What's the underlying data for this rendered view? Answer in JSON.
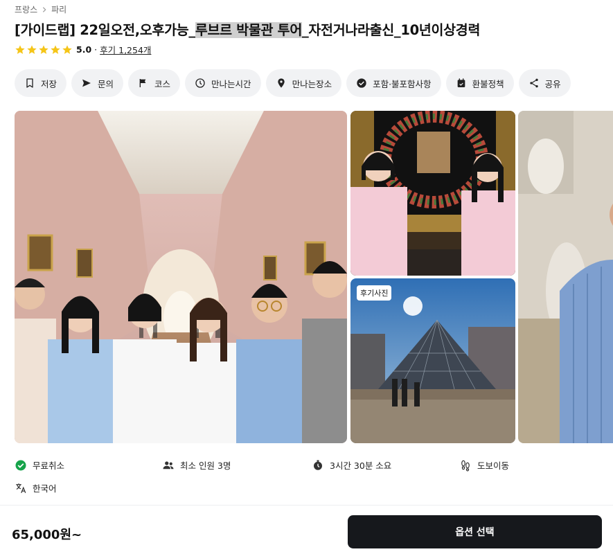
{
  "breadcrumb": {
    "items": [
      "프랑스",
      "파리"
    ]
  },
  "product": {
    "title_before": "[가이드랩] 22일오전,오후가능_",
    "title_highlight": "루브르 박물관 투어",
    "title_after": "_자전거나라출신_10년이상경력",
    "rating": "5.0",
    "separator": "·",
    "reviews": "후기 1,254개",
    "star_color": "#f5c518"
  },
  "actions": [
    {
      "label": "저장",
      "icon": "bookmark-icon"
    },
    {
      "label": "문의",
      "icon": "send-icon"
    },
    {
      "label": "코스",
      "icon": "flag-icon"
    },
    {
      "label": "만나는시간",
      "icon": "clock-icon"
    },
    {
      "label": "만나는장소",
      "icon": "location-pin-icon"
    },
    {
      "label": "포함·불포함사항",
      "icon": "check-circle-icon"
    },
    {
      "label": "환불정책",
      "icon": "calendar-icon"
    },
    {
      "label": "공유",
      "icon": "share-icon"
    }
  ],
  "gallery": {
    "review_badge": "후기사진"
  },
  "features": [
    {
      "label": "무료취소",
      "icon": "check-badge-icon"
    },
    {
      "label": "최소 인원 3명",
      "icon": "people-icon"
    },
    {
      "label": "3시간 30분 소요",
      "icon": "timer-icon"
    },
    {
      "label": "도보이동",
      "icon": "footprints-icon"
    },
    {
      "label": "한국어",
      "icon": "translate-icon"
    }
  ],
  "footer": {
    "price": "65,000원~",
    "cta": "옵션 선택",
    "accent_green": "#16a34a",
    "cta_color": "#16181c"
  }
}
